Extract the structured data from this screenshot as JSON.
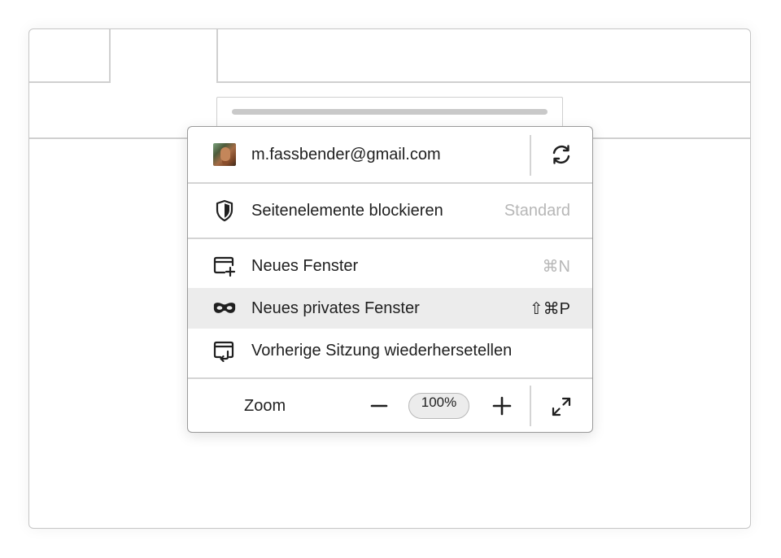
{
  "account": {
    "email": "m.fassbender@gmail.com",
    "avatar_icon": "user-avatar",
    "sync_icon": "sync-icon"
  },
  "blocking": {
    "label": "Seitenelemente blockieren",
    "value": "Standard",
    "icon": "shield-icon"
  },
  "items": [
    {
      "label": "Neues Fenster",
      "shortcut": "⌘N",
      "icon": "new-window-icon"
    },
    {
      "label": "Neues privates Fenster",
      "shortcut": "⇧⌘P",
      "icon": "private-mask-icon",
      "highlighted": true
    },
    {
      "label": "Vorherige Sitzung wiederhersetellen",
      "shortcut": "",
      "icon": "restore-session-icon"
    }
  ],
  "zoom": {
    "label": "Zoom",
    "value": "100%",
    "decrease_icon": "minus-icon",
    "increase_icon": "plus-icon",
    "fullscreen_icon": "fullscreen-icon"
  },
  "colors": {
    "highlight": "#ececec",
    "muted_text": "#b7b7b7",
    "text": "#1f1f1f"
  }
}
